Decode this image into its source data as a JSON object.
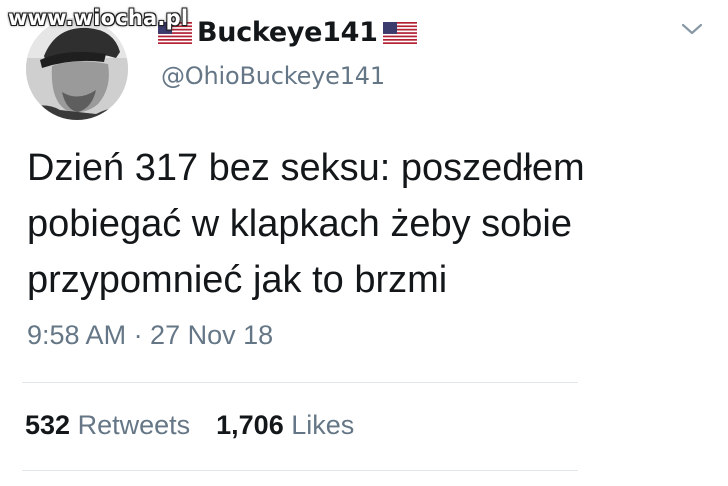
{
  "watermark": "www.wiocha.pl",
  "user": {
    "display_name": "Buckeye141",
    "handle": "@OhioBuckeye141",
    "avatar_icon": "user-avatar",
    "flag_icon": "us-flag-icon"
  },
  "tweet": {
    "lines": [
      "Dzień 317 bez seksu: poszedłem",
      "pobiegać w klapkach żeby sobie",
      "przypomnieć jak to brzmi"
    ],
    "timestamp": "9:58 AM · 27 Nov 18"
  },
  "stats": {
    "retweets_count": "532",
    "retweets_label": "Retweets",
    "likes_count": "1,706",
    "likes_label": "Likes"
  },
  "colors": {
    "text_primary": "#14171a",
    "text_secondary": "#657786",
    "divider": "#e1e8ed"
  },
  "menu_icon": "chevron-down-icon"
}
